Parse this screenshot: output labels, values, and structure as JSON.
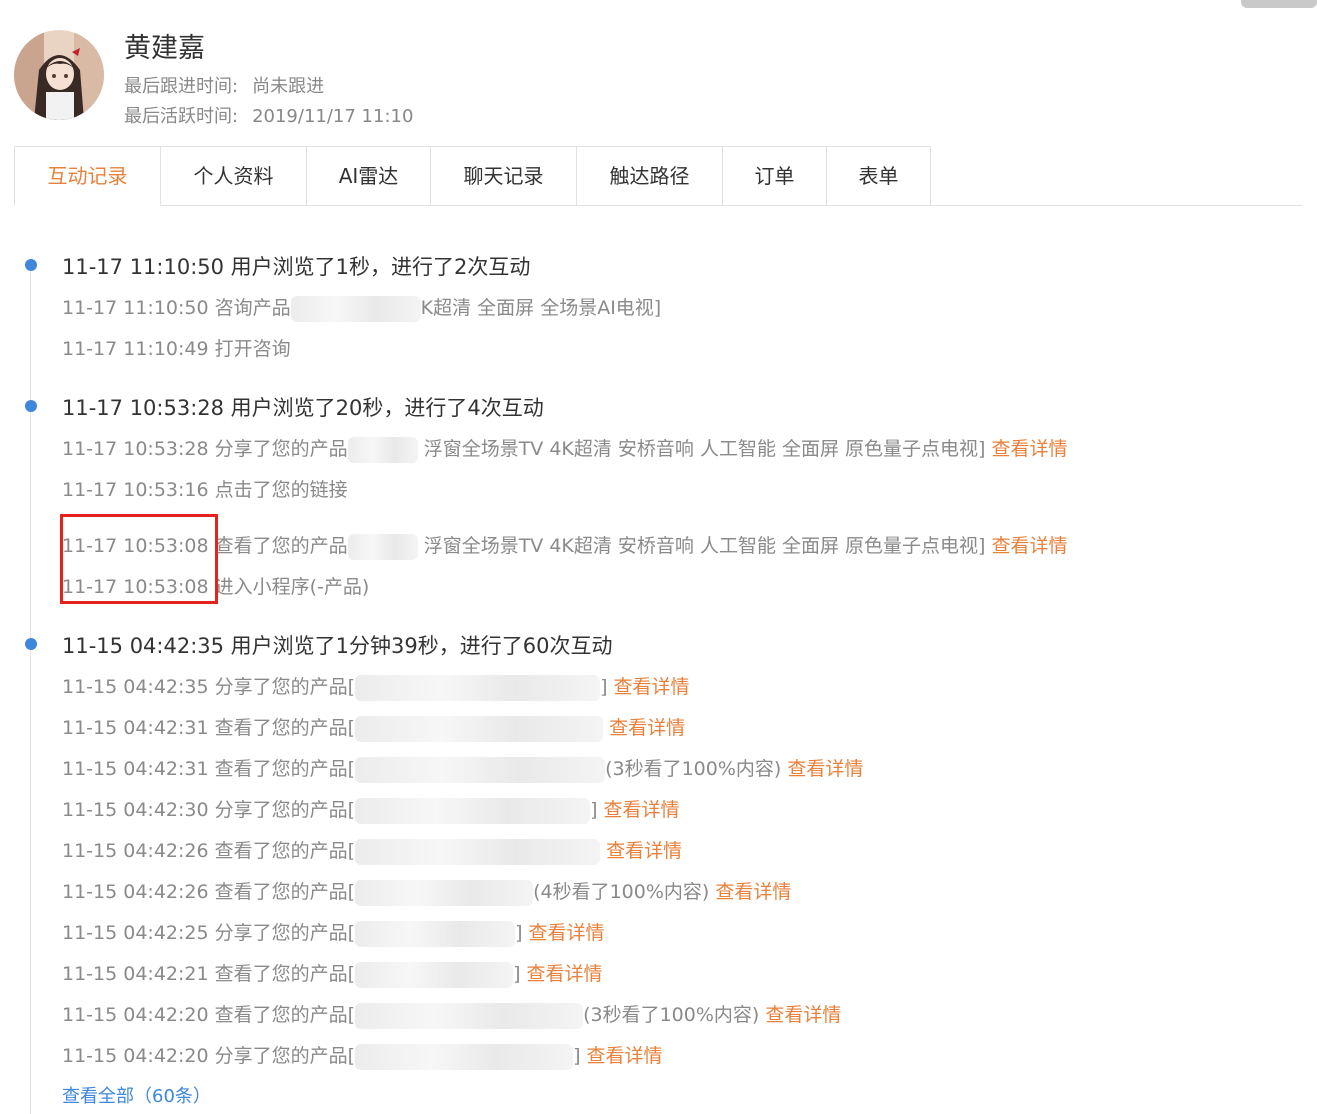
{
  "profile": {
    "name": "黄建嘉",
    "follow_label": "最后跟进时间:",
    "follow_value": "尚未跟进",
    "active_label": "最后活跃时间:",
    "active_value": "2019/11/17 11:10"
  },
  "tabs": [
    "互动记录",
    "个人资料",
    "AI雷达",
    "聊天记录",
    "触达路径",
    "订单",
    "表单"
  ],
  "timeline": {
    "groups": [
      {
        "title": "11-17 11:10:50 用户浏览了1秒，进行了2次互动",
        "items": [
          {
            "time": "11-17 11:10:50",
            "text": "咨询产品",
            "tail": "K超清 全面屏 全场景AI电视]",
            "link": ""
          },
          {
            "time": "11-17 11:10:49",
            "text": "打开咨询",
            "tail": "",
            "link": ""
          }
        ]
      },
      {
        "title": "11-17 10:53:28 用户浏览了20秒，进行了4次互动",
        "items": [
          {
            "time": "11-17 10:53:28",
            "text": "分享了您的产品",
            "tail": "浮窗全场景TV 4K超清 安桥音响 人工智能 全面屏 原色量子点电视]",
            "link": "查看详情"
          },
          {
            "time": "11-17 10:53:16",
            "text": "点击了您的链接",
            "tail": "",
            "link": ""
          },
          {
            "time": "11-17 10:53:08",
            "text": "查看了您的产品",
            "tail": "浮窗全场景TV 4K超清 安桥音响 人工智能 全面屏 原色量子点电视]",
            "link": "查看详情"
          },
          {
            "time": "11-17 10:53:08",
            "text": "进入小程序(-产品)",
            "tail": "",
            "link": ""
          }
        ]
      },
      {
        "title": "11-15 04:42:35 用户浏览了1分钟39秒，进行了60次互动",
        "items": [
          {
            "time": "11-15 04:42:35",
            "text": "分享了您的产品[",
            "tail": "]",
            "link": "查看详情"
          },
          {
            "time": "11-15 04:42:31",
            "text": "查看了您的产品[",
            "tail": "",
            "link": "查看详情"
          },
          {
            "time": "11-15 04:42:31",
            "text": "查看了您的产品[",
            "tail": "(3秒看了100%内容)",
            "link": "查看详情"
          },
          {
            "time": "11-15 04:42:30",
            "text": "分享了您的产品[",
            "tail": "]",
            "link": "查看详情"
          },
          {
            "time": "11-15 04:42:26",
            "text": "查看了您的产品[",
            "tail": "",
            "link": "查看详情"
          },
          {
            "time": "11-15 04:42:26",
            "text": "查看了您的产品[",
            "tail": "(4秒看了100%内容)",
            "link": "查看详情"
          },
          {
            "time": "11-15 04:42:25",
            "text": "分享了您的产品[",
            "tail": "]",
            "link": "查看详情"
          },
          {
            "time": "11-15 04:42:21",
            "text": "查看了您的产品[",
            "tail": "]",
            "link": "查看详情"
          },
          {
            "time": "11-15 04:42:20",
            "text": "查看了您的产品[",
            "tail": "(3秒看了100%内容)",
            "link": "查看详情"
          },
          {
            "time": "11-15 04:42:20",
            "text": "分享了您的产品[",
            "tail": "]",
            "link": "查看详情"
          }
        ]
      }
    ],
    "view_all": "查看全部（60条）"
  },
  "colors": {
    "accent": "#e8813b",
    "link_blue": "#3f87db",
    "highlight_box": "#e6221d"
  }
}
